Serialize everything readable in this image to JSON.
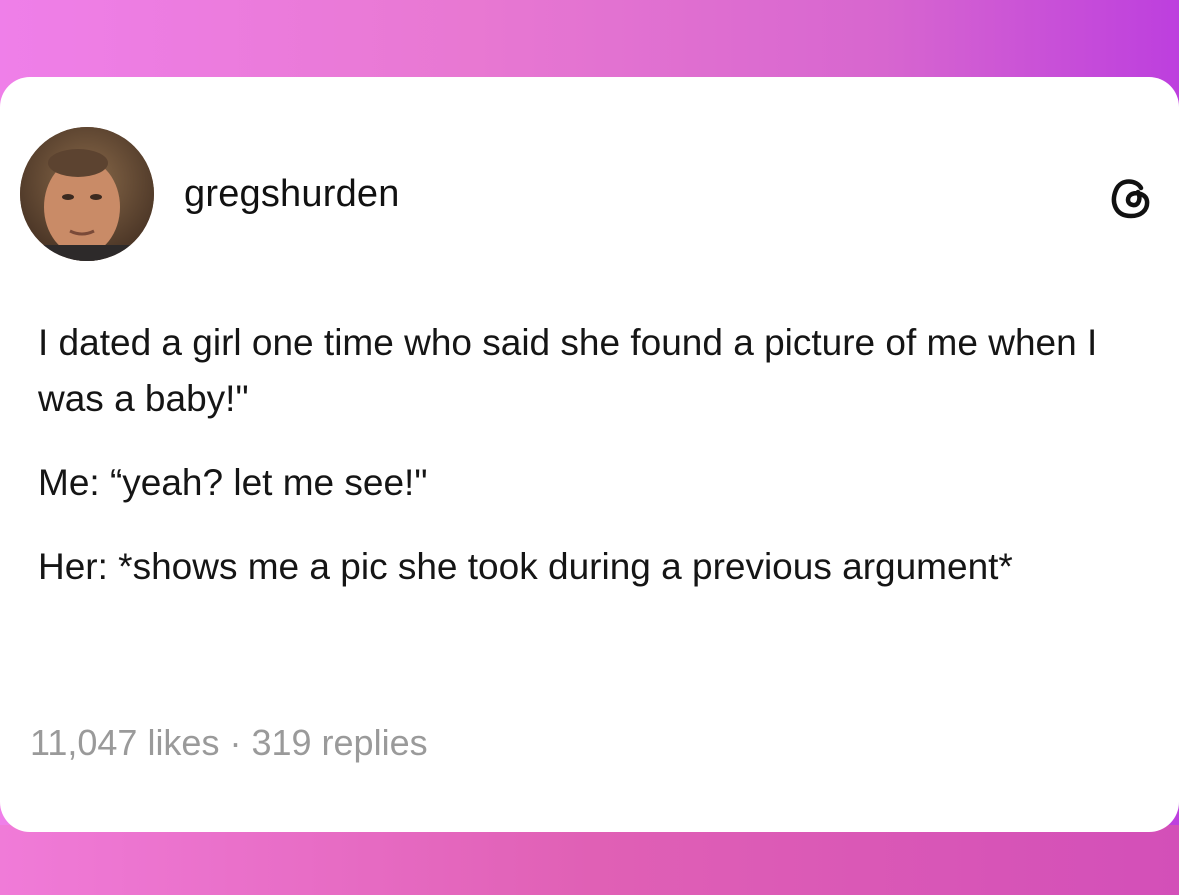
{
  "post": {
    "username": "gregshurden",
    "paragraphs": [
      "I dated a girl one time who said she found a picture of me when I was a baby!\"",
      "Me: “yeah? let me see!\"",
      "Her: *shows me a pic she took during a previous argument*"
    ],
    "likes": "11,047 likes",
    "separator": "·",
    "replies": "319 replies"
  },
  "icons": {
    "avatar": "avatar-photo",
    "brand": "threads-logo-icon"
  },
  "colors": {
    "card": "#ffffff",
    "text": "#151515",
    "stats": "#9a9a9a",
    "gradient_left": "#ef7fe9",
    "gradient_right": "#bd3fde"
  }
}
